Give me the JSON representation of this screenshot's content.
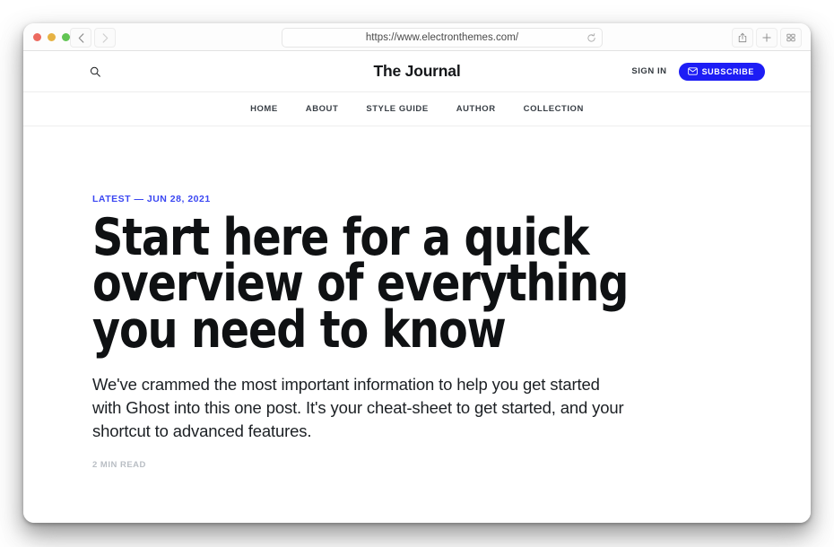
{
  "browser": {
    "url": "https://www.electronthemes.com/",
    "back_icon": "chevron-left-icon",
    "forward_icon": "chevron-right-icon",
    "reload_icon": "reload-icon",
    "share_icon": "share-icon",
    "new_tab_icon": "plus-icon",
    "tab_overview_icon": "tab-grid-icon",
    "traffic_lights": [
      "close",
      "minimize",
      "zoom"
    ]
  },
  "site": {
    "title": "The Journal",
    "search_icon": "search-icon",
    "sign_in_label": "SIGN IN",
    "subscribe_label": "SUBSCRIBE",
    "subscribe_icon": "envelope-icon",
    "accent_color": "#1d1df5",
    "nav_items": [
      {
        "label": "HOME"
      },
      {
        "label": "ABOUT"
      },
      {
        "label": "STYLE GUIDE"
      },
      {
        "label": "AUTHOR"
      },
      {
        "label": "COLLECTION"
      }
    ]
  },
  "article": {
    "meta": "LATEST — JUN 28, 2021",
    "meta_color": "#3b47f2",
    "title": "Start here for a quick overview of everything you need to know",
    "excerpt": "We've crammed the most important information to help you get started with Ghost into this one post. It's your cheat-sheet to get started, and your shortcut to advanced features.",
    "read_time": "2 MIN READ"
  }
}
